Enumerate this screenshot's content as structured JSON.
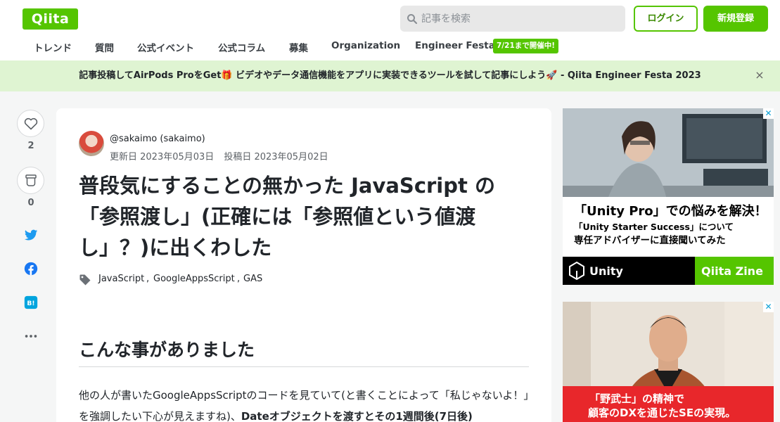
{
  "header": {
    "logo": "Qiita",
    "search_placeholder": "記事を検索",
    "login": "ログイン",
    "signup": "新規登録"
  },
  "nav": {
    "items": [
      "トレンド",
      "質問",
      "公式イベント",
      "公式コラム",
      "募集",
      "Organization",
      "Engineer Festa"
    ],
    "badge": "7/21まで開催中!"
  },
  "banner": {
    "text": "記事投稿してAirPods ProをGet🎁 ビデオやデータ通信機能をアプリに実装できるツールを試して記事にしよう🚀 - Qiita Engineer Festa 2023",
    "close": "×"
  },
  "rail": {
    "likes": "2",
    "stocks": "0"
  },
  "article": {
    "author": "@sakaimo (sakaimo)",
    "updated": "更新日 2023年05月03日",
    "posted": "投稿日 2023年05月02日",
    "title": "普段気にすることの無かった JavaScript の「参照渡し」(正確には「参照値という値渡し」？)に出くわした",
    "tags": [
      "JavaScript",
      "GoogleAppsScript",
      "GAS"
    ],
    "section_heading": "こんな事がありました",
    "paragraph_part1": "他の人が書いたGoogleAppsScriptのコードを見ていて(と書くことによって「私じゃないよ！」を強調したい下心が見えますね)、",
    "paragraph_bold": "Dateオブジェクトを渡すとその1週間後(7日後)"
  },
  "ads": {
    "ad1": {
      "line1": "「Unity Pro」での悩みを解決！",
      "line2": "「Unity Starter Success」について",
      "line3": "専任アドバイザーに直接聞いてみた",
      "brand1": "Unity",
      "brand2": "Qiita Zine"
    },
    "ad2": {
      "line1": "「野武士」の精神で",
      "line2": "顧客のDXを通じたSEの実現。"
    }
  },
  "colors": {
    "brand": "#55c500",
    "banner_bg": "#dff4d2",
    "twitter": "#1d9bf0",
    "facebook": "#1877f2",
    "hatena": "#00a4de"
  }
}
